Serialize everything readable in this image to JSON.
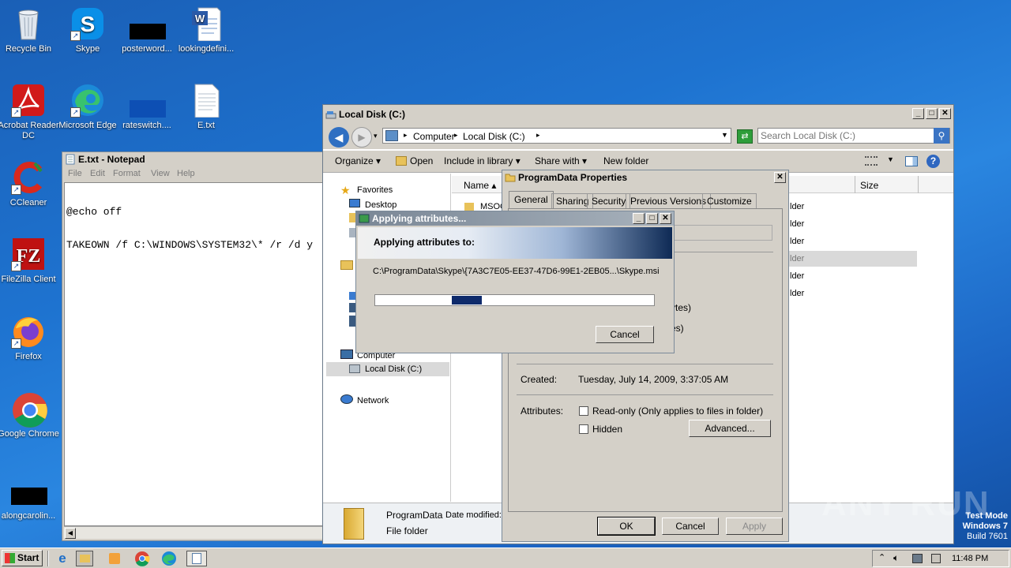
{
  "desktop": {
    "icons": [
      {
        "label": "Recycle Bin"
      },
      {
        "label": "Skype"
      },
      {
        "label": "posterword..."
      },
      {
        "label": "lookingdefini..."
      },
      {
        "label": "Acrobat Reader DC"
      },
      {
        "label": "Microsoft Edge"
      },
      {
        "label": "rateswitch...."
      },
      {
        "label": "E.txt"
      },
      {
        "label": "CCleaner"
      },
      {
        "label": "FileZilla Client"
      },
      {
        "label": "Firefox"
      },
      {
        "label": "Google Chrome"
      },
      {
        "label": "alongcarolin..."
      }
    ]
  },
  "notepad": {
    "title": "E.txt - Notepad",
    "menu": [
      "File",
      "Edit",
      "Format",
      "View",
      "Help"
    ],
    "lines": [
      "@echo off",
      "TAKEOWN /f C:\\WINDOWS\\SYSTEM32\\* /r /d y"
    ]
  },
  "explorer": {
    "title": "Local Disk (C:)",
    "breadcrumb": [
      "Computer",
      "Local Disk (C:)"
    ],
    "search_placeholder": "Search Local Disk (C:)",
    "toolbar": [
      "Organize",
      "Open",
      "Include in library",
      "Share with",
      "New folder"
    ],
    "nav": {
      "favorites": "Favorites",
      "desktop": "Desktop",
      "computer": "Computer",
      "local_disk": "Local Disk (C:)",
      "network": "Network"
    },
    "columns": {
      "name": "Name",
      "size": "Size"
    },
    "first_item": "MSOC",
    "right_fragments": [
      "lder",
      "lder",
      "lder",
      "lder",
      "lder",
      "lder"
    ],
    "details": {
      "name": "ProgramData",
      "date_label": "Date modified:",
      "type": "File folder"
    }
  },
  "properties": {
    "title": "ProgramData Properties",
    "tabs": [
      "General",
      "Sharing",
      "Security",
      "Previous Versions",
      "Customize"
    ],
    "fragments": [
      "ytes)",
      "es)"
    ],
    "created_label": "Created:",
    "created_value": "Tuesday, July 14, 2009, 3:37:05 AM",
    "attributes_label": "Attributes:",
    "readonly_label": "Read-only (Only applies to files in folder)",
    "hidden_label": "Hidden",
    "advanced_label": "Advanced...",
    "ok_label": "OK",
    "cancel_label": "Cancel",
    "apply_label": "Apply"
  },
  "applying": {
    "title": "Applying attributes...",
    "heading": "Applying attributes to:",
    "path": "C:\\ProgramData\\Skype\\{7A3C7E05-EE37-47D6-99E1-2EB05...\\Skype.msi",
    "cancel_label": "Cancel",
    "progress": 0.15
  },
  "watermark": "ANY RUN",
  "testmode": [
    "Test Mode",
    "Windows 7",
    "Build 7601"
  ],
  "taskbar": {
    "start_label": "Start",
    "clock": "11:48 PM"
  }
}
